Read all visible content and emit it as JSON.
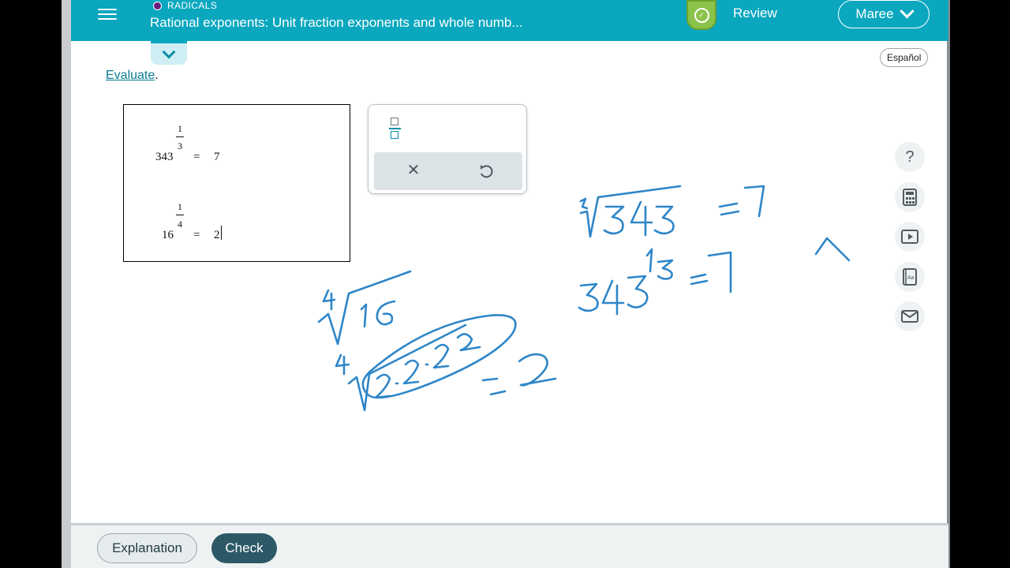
{
  "header": {
    "topic": "RADICALS",
    "lesson_title": "Rational exponents: Unit fraction exponents and whole numb...",
    "review_label": "Review",
    "user_name": "Maree"
  },
  "language_button": "Español",
  "instruction": {
    "link": "Evaluate",
    "suffix": "."
  },
  "problems": [
    {
      "base": "343",
      "numerator": "1",
      "denominator": "3",
      "equals": "=",
      "answer": "7"
    },
    {
      "base": "16",
      "numerator": "1",
      "denominator": "4",
      "equals": "=",
      "answer": "2"
    }
  ],
  "side_tools": [
    "question-icon",
    "calculator-icon",
    "video-icon",
    "dictionary-icon",
    "mail-icon"
  ],
  "question_glyph": "?",
  "footer": {
    "explanation_label": "Explanation",
    "check_label": "Check"
  },
  "colors": {
    "header": "#0aa7bf",
    "check_button": "#2d5966",
    "ink": "#2e86c8",
    "review_badge": "#8bc34a"
  }
}
